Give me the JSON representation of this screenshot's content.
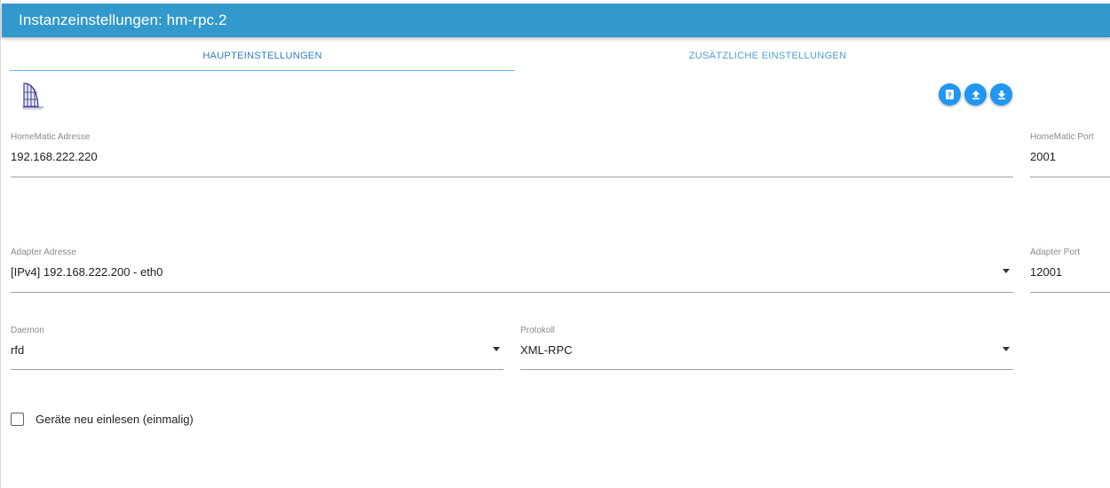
{
  "header": {
    "title": "Instanzeinstellungen: hm-rpc.2"
  },
  "tabs": [
    {
      "label": "HAUPTEINSTELLUNGEN",
      "active": true
    },
    {
      "label": "ZUSÄTZLICHE EINSTELLUNGEN",
      "active": false
    }
  ],
  "toolbar": {
    "buttons": [
      {
        "icon": "help-icon"
      },
      {
        "icon": "upload-icon"
      },
      {
        "icon": "download-icon"
      }
    ]
  },
  "fields": {
    "homematic_address": {
      "label": "HomeMatic Adresse",
      "value": "192.168.222.220"
    },
    "homematic_port": {
      "label": "HomeMatic Port",
      "value": "2001"
    },
    "adapter_address": {
      "label": "Adapter Adresse",
      "value": "[IPv4] 192.168.222.200 - eth0"
    },
    "adapter_port": {
      "label": "Adapter Port",
      "value": "12001"
    },
    "daemon": {
      "label": "Daemon",
      "value": "rfd"
    },
    "protocol": {
      "label": "Protokoll",
      "value": "XML-RPC"
    }
  },
  "checkbox": {
    "label": "Geräte neu einlesen (einmalig)",
    "checked": false
  },
  "colors": {
    "header": "#3399cc",
    "accent": "#2196f3",
    "tab_text": "#2b7fc4"
  }
}
